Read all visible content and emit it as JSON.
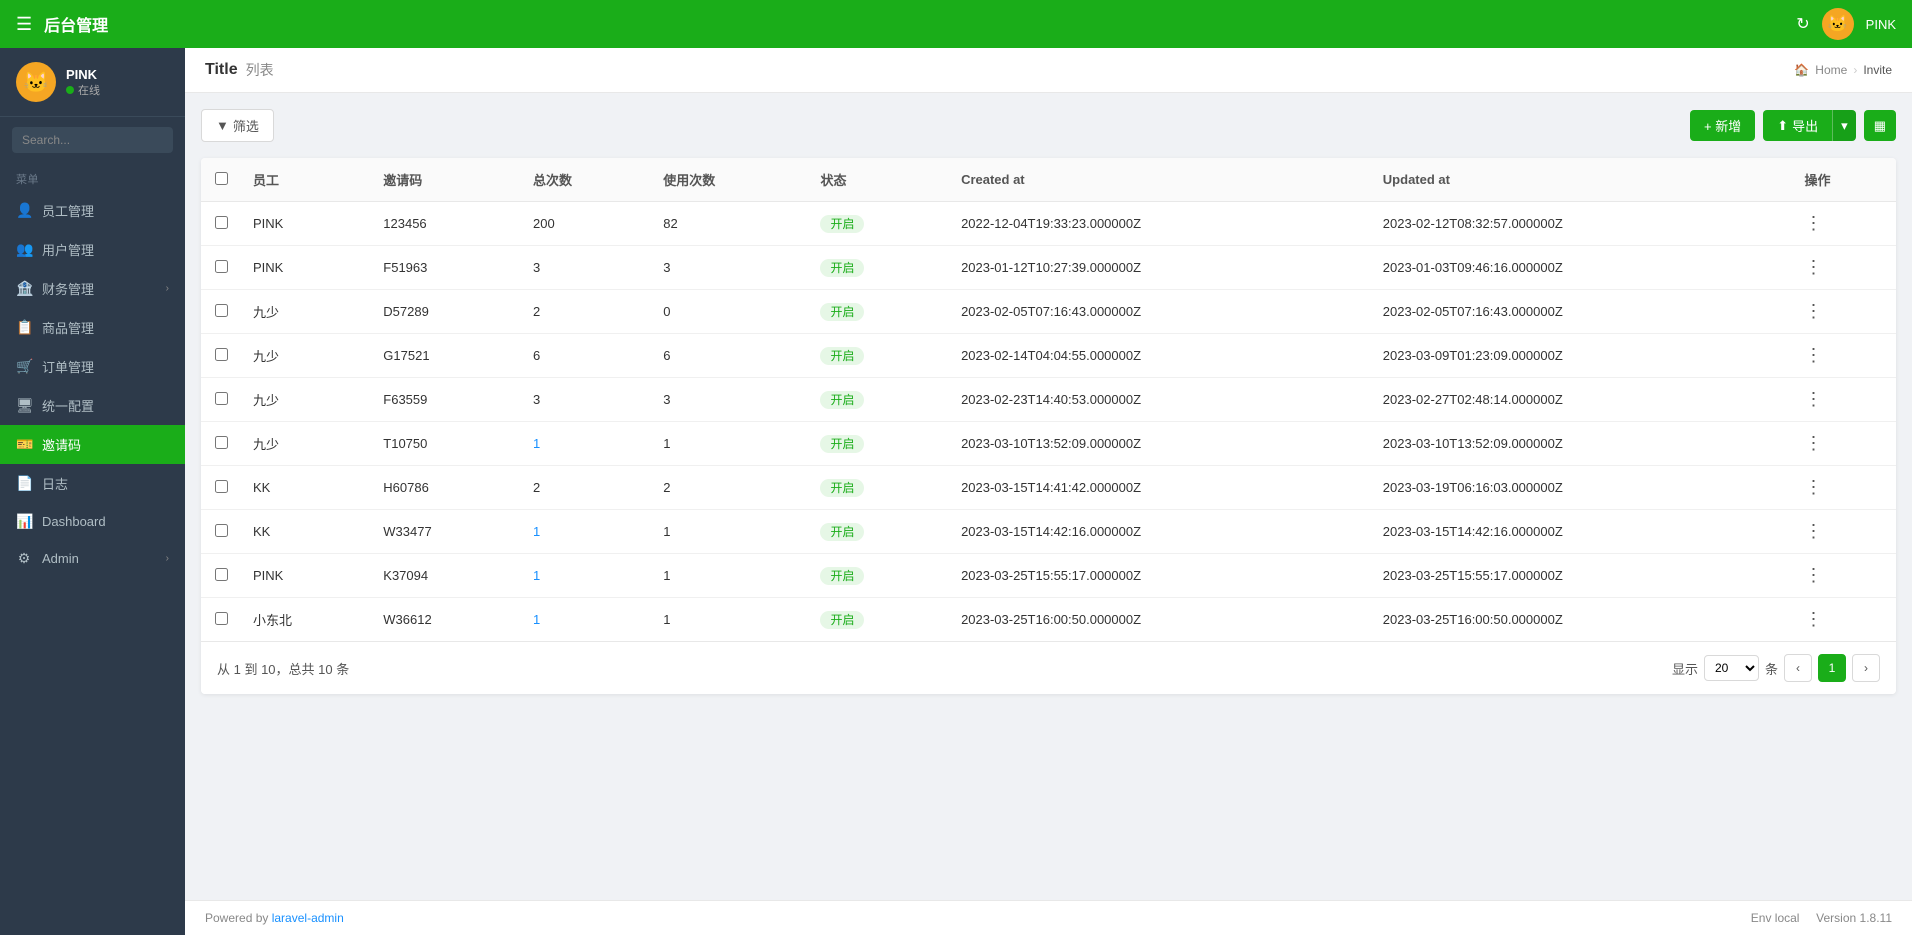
{
  "topBar": {
    "title": "后台管理",
    "hamburgerIcon": "☰",
    "refreshIcon": "↻",
    "userIcon": "🐱",
    "userName": "PINK"
  },
  "sidebar": {
    "user": {
      "name": "PINK",
      "status": "在线",
      "avatarIcon": "🐱"
    },
    "searchPlaceholder": "Search...",
    "menuLabel": "菜单",
    "items": [
      {
        "id": "staff",
        "icon": "👤",
        "label": "员工管理",
        "active": false,
        "hasArrow": false
      },
      {
        "id": "users",
        "icon": "👥",
        "label": "用户管理",
        "active": false,
        "hasArrow": false
      },
      {
        "id": "finance",
        "icon": "🏦",
        "label": "财务管理",
        "active": false,
        "hasArrow": true
      },
      {
        "id": "goods",
        "icon": "📋",
        "label": "商品管理",
        "active": false,
        "hasArrow": false
      },
      {
        "id": "orders",
        "icon": "🛒",
        "label": "订单管理",
        "active": false,
        "hasArrow": false
      },
      {
        "id": "config",
        "icon": "🖥",
        "label": "统一配置",
        "active": false,
        "hasArrow": false
      },
      {
        "id": "invite",
        "icon": "🎫",
        "label": "邀请码",
        "active": true,
        "hasArrow": false
      },
      {
        "id": "logs",
        "icon": "📄",
        "label": "日志",
        "active": false,
        "hasArrow": false
      },
      {
        "id": "dashboard",
        "icon": "📊",
        "label": "Dashboard",
        "active": false,
        "hasArrow": false
      },
      {
        "id": "admin",
        "icon": "⚙",
        "label": "Admin",
        "active": false,
        "hasArrow": true
      }
    ]
  },
  "page": {
    "title": "Title",
    "subtitle": "列表",
    "breadcrumb": {
      "home": "Home",
      "current": "Invite"
    }
  },
  "toolbar": {
    "filterLabel": "筛选",
    "addLabel": "+ 新增",
    "exportLabel": "导出",
    "columnsLabel": "▦"
  },
  "table": {
    "columns": [
      "",
      "员工",
      "邀请码",
      "总次数",
      "使用次数",
      "状态",
      "Created at",
      "Updated at",
      "操作"
    ],
    "rows": [
      {
        "employee": "PINK",
        "code": "123456",
        "total": "200",
        "used": "82",
        "status": "开启",
        "createdAt": "2022-12-04T19:33:23.000000Z",
        "updatedAt": "2023-02-12T08:32:57.000000Z",
        "usedIsLink": false,
        "totalIsLink": false
      },
      {
        "employee": "PINK",
        "code": "F51963",
        "total": "3",
        "used": "3",
        "status": "开启",
        "createdAt": "2023-01-12T10:27:39.000000Z",
        "updatedAt": "2023-01-03T09:46:16.000000Z",
        "usedIsLink": false,
        "totalIsLink": false
      },
      {
        "employee": "九少",
        "code": "D57289",
        "total": "2",
        "used": "0",
        "status": "开启",
        "createdAt": "2023-02-05T07:16:43.000000Z",
        "updatedAt": "2023-02-05T07:16:43.000000Z",
        "usedIsLink": false,
        "totalIsLink": false
      },
      {
        "employee": "九少",
        "code": "G17521",
        "total": "6",
        "used": "6",
        "status": "开启",
        "createdAt": "2023-02-14T04:04:55.000000Z",
        "updatedAt": "2023-03-09T01:23:09.000000Z",
        "usedIsLink": false,
        "totalIsLink": false
      },
      {
        "employee": "九少",
        "code": "F63559",
        "total": "3",
        "used": "3",
        "status": "开启",
        "createdAt": "2023-02-23T14:40:53.000000Z",
        "updatedAt": "2023-02-27T02:48:14.000000Z",
        "usedIsLink": false,
        "totalIsLink": false
      },
      {
        "employee": "九少",
        "code": "T10750",
        "total": "1",
        "used": "1",
        "status": "开启",
        "createdAt": "2023-03-10T13:52:09.000000Z",
        "updatedAt": "2023-03-10T13:52:09.000000Z",
        "totalIsLink": true,
        "usedIsLink": false
      },
      {
        "employee": "KK",
        "code": "H60786",
        "total": "2",
        "used": "2",
        "status": "开启",
        "createdAt": "2023-03-15T14:41:42.000000Z",
        "updatedAt": "2023-03-19T06:16:03.000000Z",
        "usedIsLink": false,
        "totalIsLink": false
      },
      {
        "employee": "KK",
        "code": "W33477",
        "total": "1",
        "used": "1",
        "status": "开启",
        "createdAt": "2023-03-15T14:42:16.000000Z",
        "updatedAt": "2023-03-15T14:42:16.000000Z",
        "totalIsLink": true,
        "usedIsLink": false
      },
      {
        "employee": "PINK",
        "code": "K37094",
        "total": "1",
        "used": "1",
        "status": "开启",
        "createdAt": "2023-03-25T15:55:17.000000Z",
        "updatedAt": "2023-03-25T15:55:17.000000Z",
        "totalIsLink": true,
        "usedIsLink": false
      },
      {
        "employee": "小东北",
        "code": "W36612",
        "total": "1",
        "used": "1",
        "status": "开启",
        "createdAt": "2023-03-25T16:00:50.000000Z",
        "updatedAt": "2023-03-25T16:00:50.000000Z",
        "totalIsLink": true,
        "usedIsLink": false
      }
    ],
    "paginationInfo": "从 1 到 10，总共 10 条",
    "showLabel": "显示",
    "perPageSuffix": "条",
    "pageSize": "20",
    "currentPage": "1"
  },
  "footer": {
    "poweredBy": "Powered by",
    "link": "laravel-admin",
    "env": "Env local",
    "version": "Version  1.8.11"
  }
}
